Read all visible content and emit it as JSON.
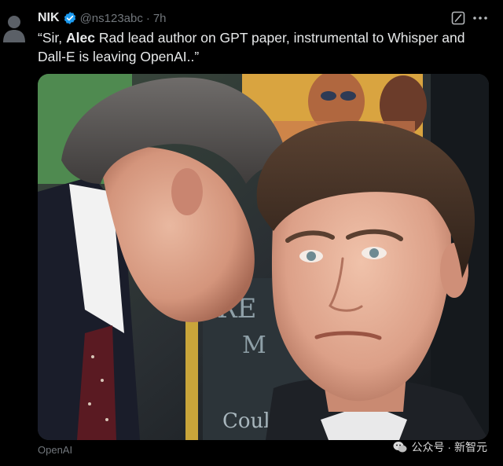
{
  "tweet": {
    "display_name": "NIK",
    "handle": "@ns123abc",
    "separator": "·",
    "time": "7h",
    "text_open": "“Sir, ",
    "text_bold": "Alec",
    "text_rest": " Rad lead author on GPT paper, instrumental to Whisper and Dall-E is leaving OpenAI..”",
    "media_caption": "OpenAI"
  },
  "watermark": {
    "text": "公众号 · 新智元"
  },
  "icons": {
    "avatar": "default-avatar-icon",
    "verified": "verified-badge-icon",
    "grok": "grok-icon",
    "more": "more-icon",
    "watermark": "wechat-icon"
  },
  "colors": {
    "background": "#000000",
    "text": "#e7e9ea",
    "muted": "#71767b",
    "verified": "#1d9bf0"
  }
}
